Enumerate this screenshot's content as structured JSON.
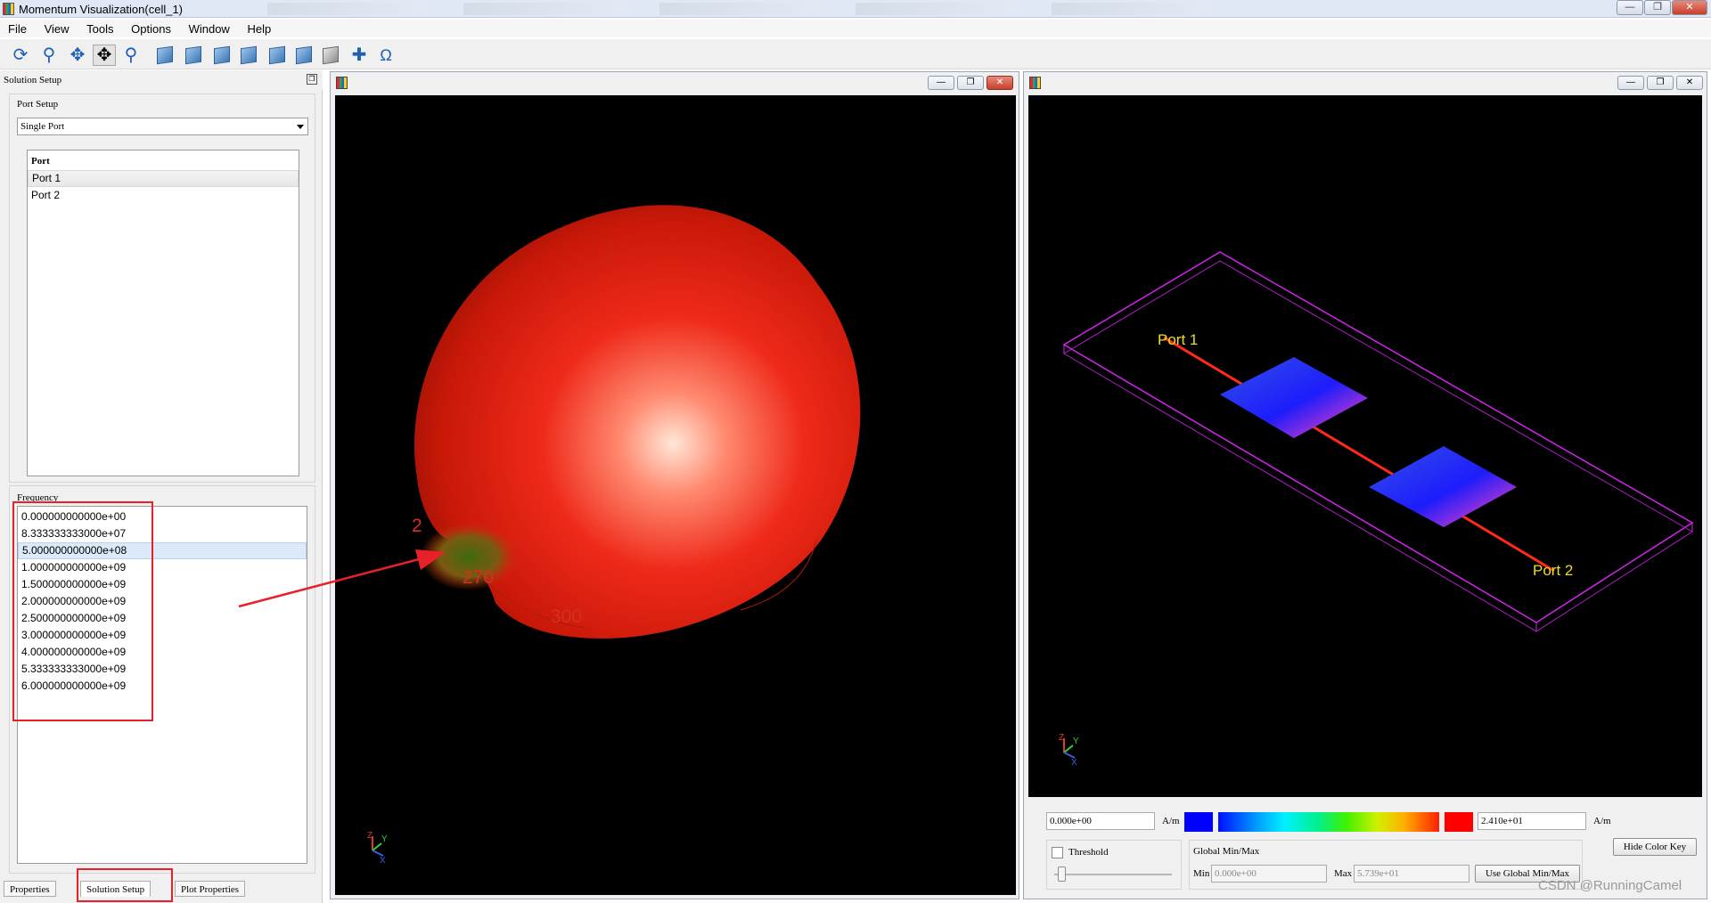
{
  "window": {
    "title": "Momentum Visualization(cell_1)"
  },
  "menu": [
    "File",
    "View",
    "Tools",
    "Options",
    "Window",
    "Help"
  ],
  "left_panel": {
    "header": "Solution Setup",
    "port_setup": {
      "title": "Port Setup",
      "mode": "Single Port",
      "list_header": "Port",
      "ports": [
        "Port 1",
        "Port 2"
      ],
      "selected_port": "Port 1"
    },
    "frequency": {
      "title": "Frequency",
      "values": [
        "0.000000000000e+00",
        "8.333333333000e+07",
        "5.000000000000e+08",
        "1.000000000000e+09",
        "1.500000000000e+09",
        "2.000000000000e+09",
        "2.500000000000e+09",
        "3.000000000000e+09",
        "4.000000000000e+09",
        "5.333333333000e+09",
        "6.000000000000e+09"
      ],
      "selected_index": 2
    },
    "tabs": [
      "Properties",
      "Solution Setup",
      "Plot Properties"
    ]
  },
  "radiation_view": {
    "axis_labels": [
      "270",
      "300",
      "2"
    ],
    "triad": [
      "Z",
      "Y",
      "X"
    ]
  },
  "layout_view": {
    "port_labels": [
      "Port 1",
      "Port 2"
    ],
    "triad": [
      "Z",
      "Y",
      "X"
    ]
  },
  "color_key": {
    "min_value": "0.000e+00",
    "max_value": "2.410e+01",
    "unit": "A/m",
    "threshold_label": "Threshold",
    "global_title": "Global Min/Max",
    "global_min_label": "Min",
    "global_min": "0.000e+00",
    "global_max_label": "Max",
    "global_max": "5.739e+01",
    "use_global_button": "Use Global Min/Max",
    "hide_button": "Hide Color Key",
    "colors": {
      "min": "#0000ff",
      "max": "#ff0000"
    }
  },
  "watermark": "CSDN @RunningCamel"
}
